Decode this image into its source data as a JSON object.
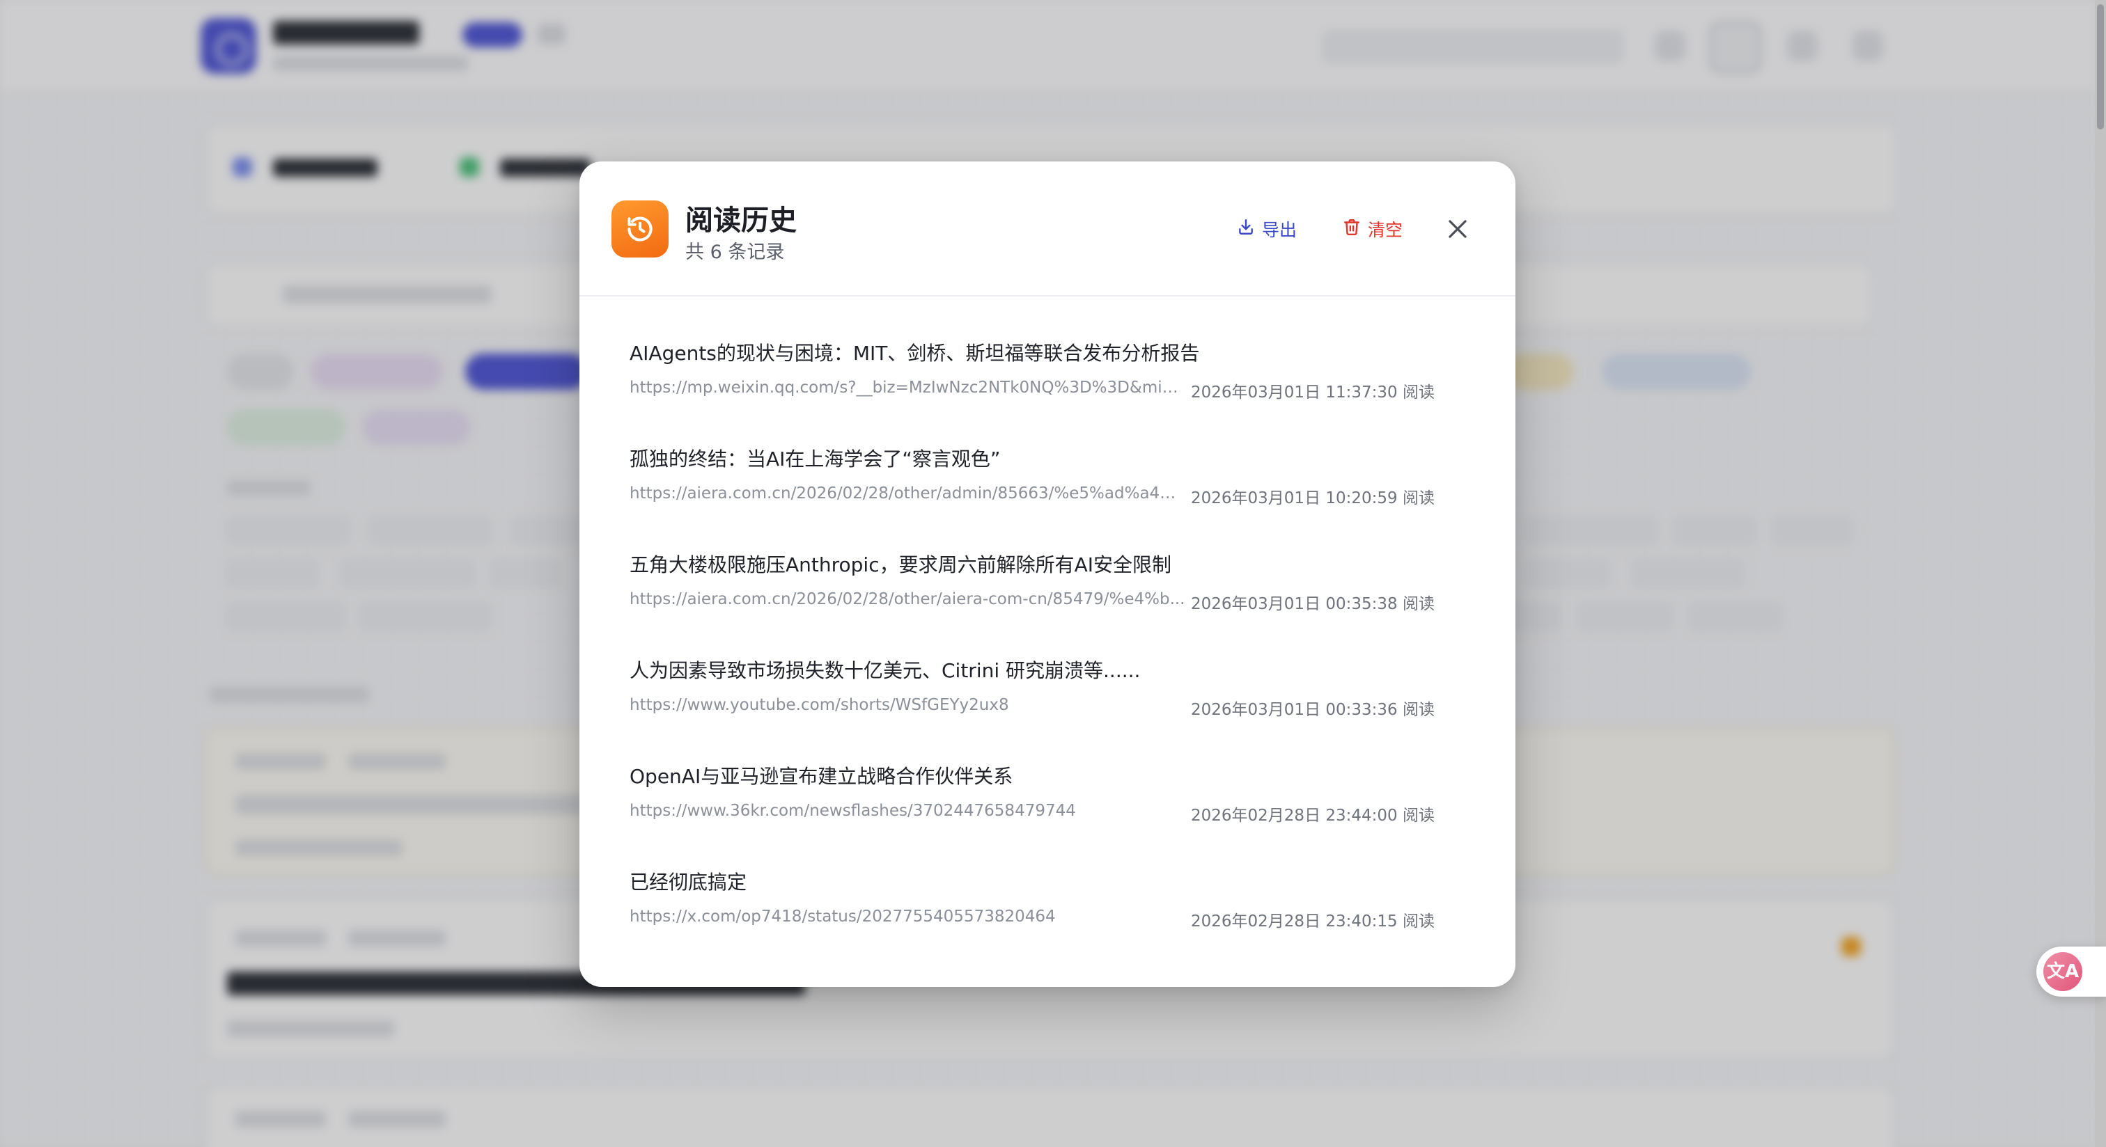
{
  "modal": {
    "title": "阅读历史",
    "subtitle": "共 6 条记录",
    "export_label": "导出",
    "clear_label": "清空",
    "accent_color": "#f26a12",
    "export_color": "#3b47c9",
    "clear_color": "#e0332c",
    "icons": {
      "header": "history-clock-icon",
      "export": "download-icon",
      "clear": "trash-icon",
      "close": "close-icon"
    }
  },
  "history": [
    {
      "title": "AIAgents的现状与困境：MIT、剑桥、斯坦福等联合发布分析报告",
      "url": "https://mp.weixin.qq.com/s?__biz=MzIwNzc2NTk0NQ%3D%3D&mid...",
      "time": "2026年03月01日 11:37:30 阅读"
    },
    {
      "title": "孤独的终结：当AI在上海学会了“察言观色”",
      "url": "https://aiera.com.cn/2026/02/28/other/admin/85663/%e5%ad%a4%...",
      "time": "2026年03月01日 10:20:59 阅读"
    },
    {
      "title": "五角大楼极限施压Anthropic，要求周六前解除所有AI安全限制",
      "url": "https://aiera.com.cn/2026/02/28/other/aiera-com-cn/85479/%e4%b...",
      "time": "2026年03月01日 00:35:38 阅读"
    },
    {
      "title": "人为因素导致市场损失数十亿美元、Citrini 研究崩溃等......",
      "url": "https://www.youtube.com/shorts/WSfGEYy2ux8",
      "time": "2026年03月01日 00:33:36 阅读"
    },
    {
      "title": "OpenAI与亚马逊宣布建立战略合作伙伴关系",
      "url": "https://www.36kr.com/newsflashes/3702447658479744",
      "time": "2026年02月28日 23:44:00 阅读"
    },
    {
      "title": "已经彻底搞定",
      "url": "https://x.com/op7418/status/2027755405573820464",
      "time": "2026年02月28日 23:40:15 阅读"
    }
  ],
  "floating_button": {
    "icon": "translate-icon",
    "glyph": "文A"
  }
}
